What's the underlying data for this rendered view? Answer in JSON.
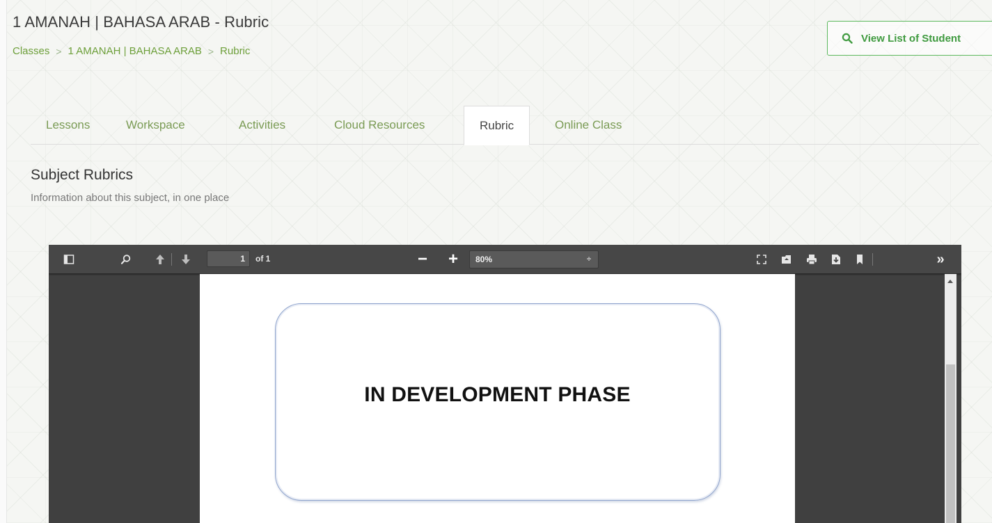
{
  "header": {
    "title": "1 AMANAH | BAHASA ARAB - Rubric",
    "breadcrumb": {
      "item1": "Classes",
      "item2": "1 AMANAH | BAHASA ARAB",
      "item3": "Rubric",
      "separator": ">"
    },
    "view_students_label": "View List of Student"
  },
  "tabs": [
    {
      "label": "Lessons"
    },
    {
      "label": "Workspace"
    },
    {
      "label": "Activities"
    },
    {
      "label": "Cloud Resources"
    },
    {
      "label": "Rubric",
      "active": true
    },
    {
      "label": "Online Class"
    }
  ],
  "section": {
    "title": "Subject Rubrics",
    "subtitle": "Information about this subject, in one place"
  },
  "pdf_viewer": {
    "page_number": "1",
    "page_count": "of 1",
    "zoom": "80%",
    "zoom_caret": "÷",
    "zoom_out_symbol": "−",
    "zoom_in_symbol": "+",
    "more_tools_symbol": "»",
    "document_text": "IN DEVELOPMENT PHASE"
  },
  "colors": {
    "accent_green": "#6d9f3a",
    "button_green": "#5cb85c",
    "toolbar_bg": "#474747",
    "viewer_bg": "#404040"
  }
}
